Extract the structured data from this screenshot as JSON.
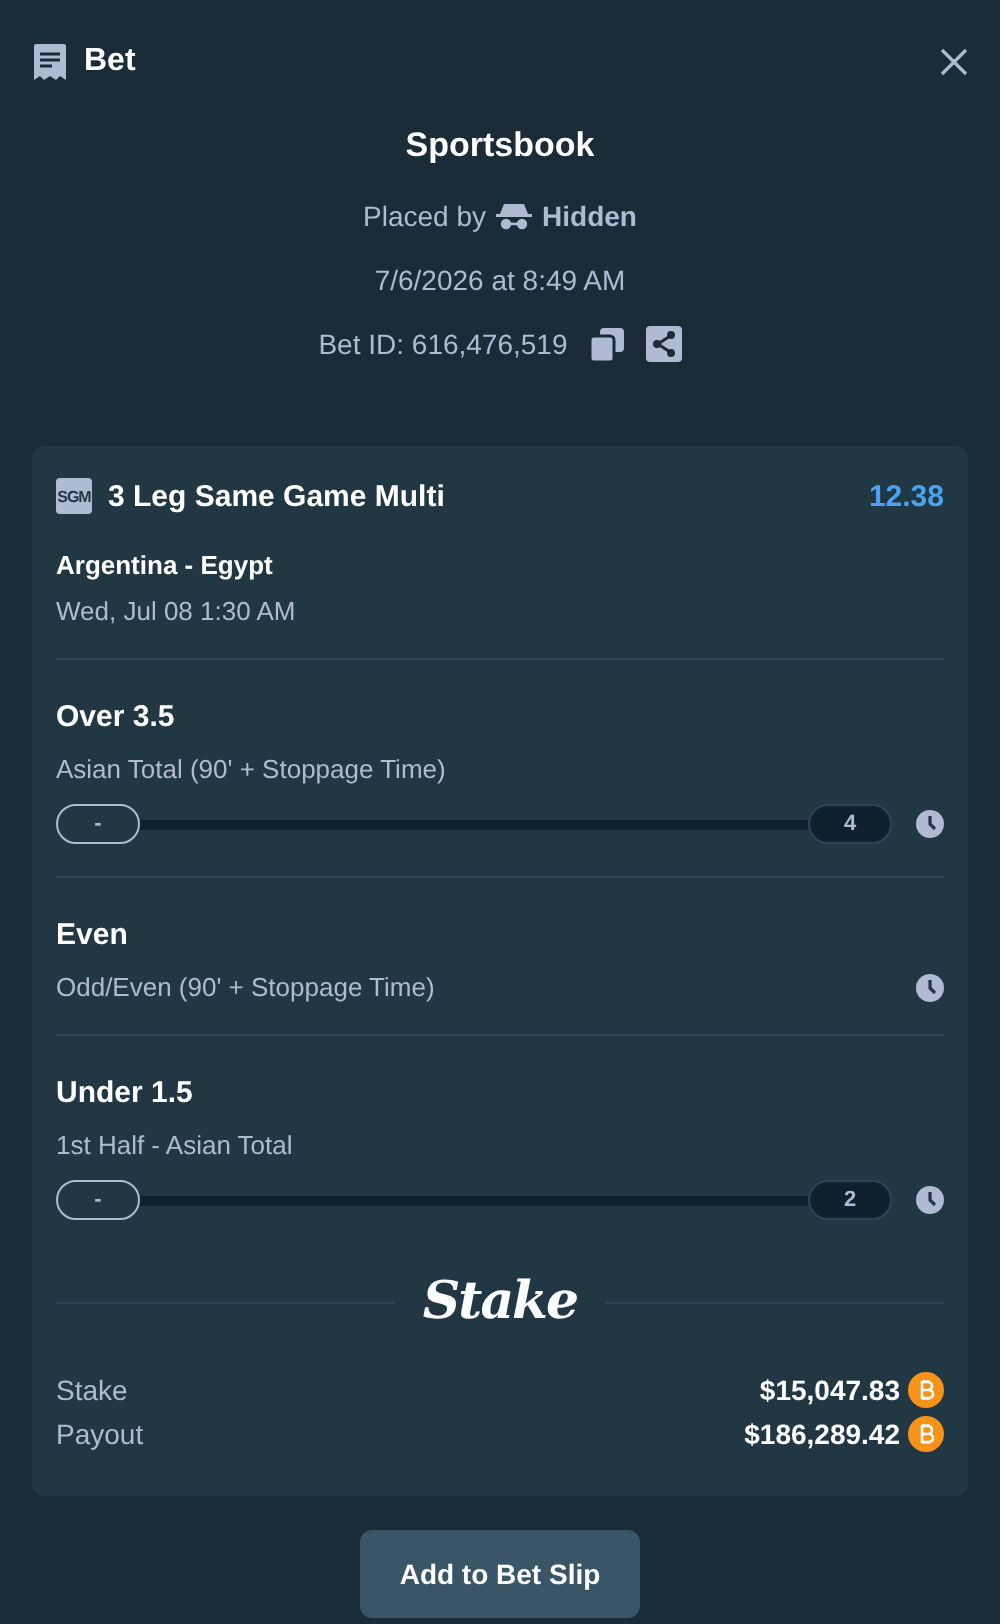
{
  "header": {
    "title": "Bet"
  },
  "summary": {
    "title": "Sportsbook",
    "placed_by_label": "Placed by",
    "placed_by_user": "Hidden",
    "date": "7/6/2026 at 8:49 AM",
    "bet_id": "Bet ID: 616,476,519"
  },
  "bet": {
    "badge": "SGM",
    "title": "3 Leg Same Game Multi",
    "odds": "12.38",
    "event": "Argentina - Egypt",
    "event_time": "Wed, Jul 08 1:30 AM",
    "legs": [
      {
        "kind": "progress",
        "selection": "Over 3.5",
        "market": "Asian Total (90' + Stoppage Time)",
        "current": "-",
        "target": "4",
        "level": 0
      },
      {
        "kind": "plain",
        "selection": "Even",
        "market": "Odd/Even (90' + Stoppage Time)"
      },
      {
        "kind": "progress",
        "selection": "Under 1.5",
        "market": "1st Half - Asian Total",
        "current": "-",
        "target": "2",
        "level": 0
      }
    ],
    "logo": "Stake",
    "totals": [
      {
        "label": "Stake",
        "amount": "$15,047.83"
      },
      {
        "label": "Payout",
        "amount": "$186,289.42"
      }
    ]
  },
  "button": "Add to Bet Slip"
}
